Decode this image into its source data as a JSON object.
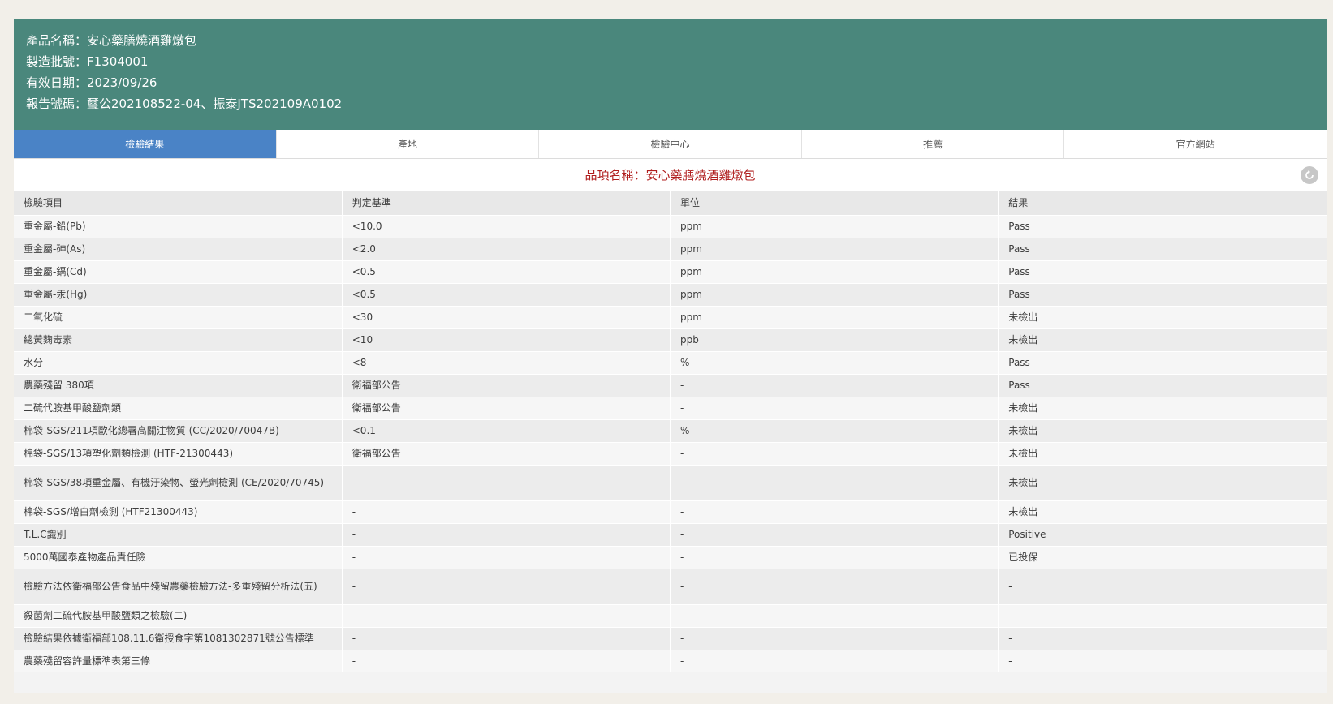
{
  "header": {
    "product_name": "產品名稱：安心藥膳燒酒雞燉包",
    "batch_no": "製造批號：F1304001",
    "expiry_date": "有效日期：2023/09/26",
    "report_no": "報告號碼：璽公202108522-04、振泰JTS202109A0102"
  },
  "tabs": [
    {
      "label": "檢驗結果"
    },
    {
      "label": "產地"
    },
    {
      "label": "檢驗中心"
    },
    {
      "label": "推薦"
    },
    {
      "label": "官方網站"
    }
  ],
  "item_title": "品項名稱：安心藥膳燒酒雞燉包",
  "table": {
    "columns": [
      "檢驗項目",
      "判定基準",
      "單位",
      "結果"
    ],
    "rows": [
      {
        "item": "重金屬-鉛(Pb)",
        "standard": "<10.0",
        "unit": "ppm",
        "result": "Pass"
      },
      {
        "item": "重金屬-砷(As)",
        "standard": "<2.0",
        "unit": "ppm",
        "result": "Pass"
      },
      {
        "item": "重金屬-鎘(Cd)",
        "standard": "<0.5",
        "unit": "ppm",
        "result": "Pass"
      },
      {
        "item": "重金屬-汞(Hg)",
        "standard": "<0.5",
        "unit": "ppm",
        "result": "Pass"
      },
      {
        "item": "二氧化硫",
        "standard": "<30",
        "unit": "ppm",
        "result": "未檢出"
      },
      {
        "item": "總黃麴毒素",
        "standard": "<10",
        "unit": "ppb",
        "result": "未檢出"
      },
      {
        "item": "水分",
        "standard": "<8",
        "unit": "%",
        "result": "Pass"
      },
      {
        "item": "農藥殘留 380項",
        "standard": "衛福部公告",
        "unit": "-",
        "result": "Pass"
      },
      {
        "item": "二硫代胺基甲酸鹽劑類",
        "standard": "衛福部公告",
        "unit": "-",
        "result": "未檢出"
      },
      {
        "item": "棉袋-SGS/211項歐化總署高關注物質 (CC/2020/70047B)",
        "standard": "<0.1",
        "unit": "%",
        "result": "未檢出"
      },
      {
        "item": "棉袋-SGS/13項塑化劑類檢測 (HTF-21300443)",
        "standard": "衛福部公告",
        "unit": "-",
        "result": "未檢出"
      },
      {
        "item": "棉袋-SGS/38項重金屬、有機汙染物、螢光劑檢測 (CE/2020/70745)",
        "standard": "-",
        "unit": "-",
        "result": "未檢出"
      },
      {
        "item": "棉袋-SGS/增白劑檢測 (HTF21300443)",
        "standard": "-",
        "unit": "-",
        "result": "未檢出"
      },
      {
        "item": "T.L.C識別",
        "standard": "-",
        "unit": "-",
        "result": "Positive"
      },
      {
        "item": "5000萬國泰產物產品責任險",
        "standard": "-",
        "unit": "-",
        "result": "已投保"
      },
      {
        "item": "檢驗方法依衛福部公告食品中殘留農藥檢驗方法-多重殘留分析法(五)",
        "standard": "-",
        "unit": "-",
        "result": "-"
      },
      {
        "item": "殺菌劑二硫代胺基甲酸鹽類之檢驗(二)",
        "standard": "-",
        "unit": "-",
        "result": "-"
      },
      {
        "item": "檢驗結果依據衛福部108.11.6衛授食字第1081302871號公告標準",
        "standard": "-",
        "unit": "-",
        "result": "-"
      },
      {
        "item": "農藥殘留容許量標準表第三條",
        "standard": "-",
        "unit": "-",
        "result": "-"
      }
    ]
  },
  "colors": {
    "header_bg": "#4a877c",
    "active_tab": "#4a83c6",
    "title_text": "#b01e1e"
  },
  "icons": {
    "back": "circle-arrow-left-icon"
  }
}
